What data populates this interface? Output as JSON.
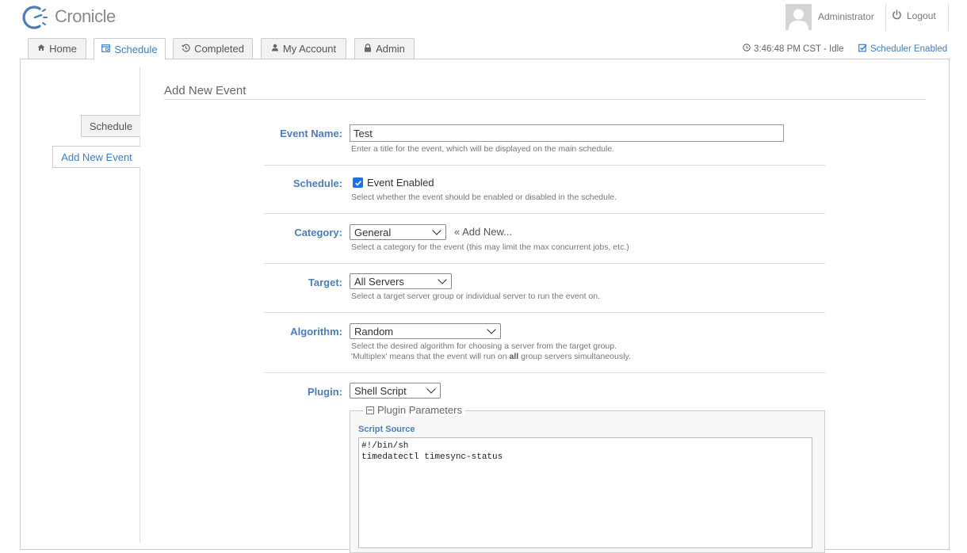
{
  "app": {
    "name": "Cronicle"
  },
  "header": {
    "user_name": "Administrator",
    "logout_label": "Logout"
  },
  "tabs": [
    {
      "label": "Home",
      "icon": "home-icon"
    },
    {
      "label": "Schedule",
      "icon": "calendar-icon",
      "active": true
    },
    {
      "label": "Completed",
      "icon": "history-icon"
    },
    {
      "label": "My Account",
      "icon": "user-icon"
    },
    {
      "label": "Admin",
      "icon": "lock-icon"
    }
  ],
  "status": {
    "clock": "3:46:48 PM CST - Idle",
    "scheduler": "Scheduler Enabled"
  },
  "side_tabs": [
    {
      "label": "Schedule"
    },
    {
      "label": "Add New Event",
      "active": true
    }
  ],
  "page": {
    "title": "Add New Event"
  },
  "form": {
    "event_name": {
      "label": "Event Name:",
      "value": "Test",
      "caption": "Enter a title for the event, which will be displayed on the main schedule."
    },
    "schedule": {
      "label": "Schedule:",
      "checkbox_label": "Event Enabled",
      "checked": true,
      "caption": "Select whether the event should be enabled or disabled in the schedule."
    },
    "category": {
      "label": "Category:",
      "value": "General",
      "add_new": "« Add New...",
      "caption": "Select a category for the event (this may limit the max concurrent jobs, etc.)"
    },
    "target": {
      "label": "Target:",
      "value": "All Servers",
      "caption": "Select a target server group or individual server to run the event on."
    },
    "algorithm": {
      "label": "Algorithm:",
      "value": "Random",
      "caption_line1": "Select the desired algorithm for choosing a server from the target group.",
      "caption_line2_pre": "'Multiplex' means that the event will run on ",
      "caption_line2_bold": "all",
      "caption_line2_post": " group servers simultaneously."
    },
    "plugin": {
      "label": "Plugin:",
      "value": "Shell Script",
      "params_legend": "Plugin Parameters",
      "script_label": "Script Source",
      "script_source": "#!/bin/sh\ntimedatectl timesync-status"
    }
  },
  "colors": {
    "accent": "#4a7dba",
    "link": "#3e7dc4",
    "checkbox": "#1a73e8"
  }
}
